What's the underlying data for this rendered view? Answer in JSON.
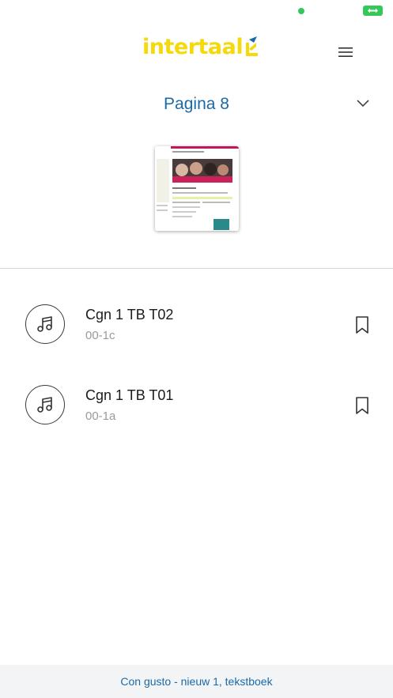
{
  "status_bar": {
    "dot_color": "#34c759",
    "battery_color": "#34c759",
    "battery_icon": "battery-charging-icon"
  },
  "header": {
    "logo_text": "intertaal",
    "logo_color": "#f5d90a",
    "logo_accent_color": "#1a6aa8",
    "menu_icon": "hamburger-menu-icon"
  },
  "page_selector": {
    "label": "Pagina 8",
    "icon": "chevron-down-icon",
    "color": "#1a6aa8"
  },
  "thumbnail": {
    "alt": "page-8-thumbnail"
  },
  "tracks": [
    {
      "title": "Cgn 1 TB T02",
      "code": "00-1c",
      "icon": "music-note-icon",
      "action_icon": "bookmark-icon"
    },
    {
      "title": "Cgn 1 TB T01",
      "code": "00-1a",
      "icon": "music-note-icon",
      "action_icon": "bookmark-icon"
    }
  ],
  "footer": {
    "book_title": "Con gusto - nieuw 1, tekstboek"
  }
}
